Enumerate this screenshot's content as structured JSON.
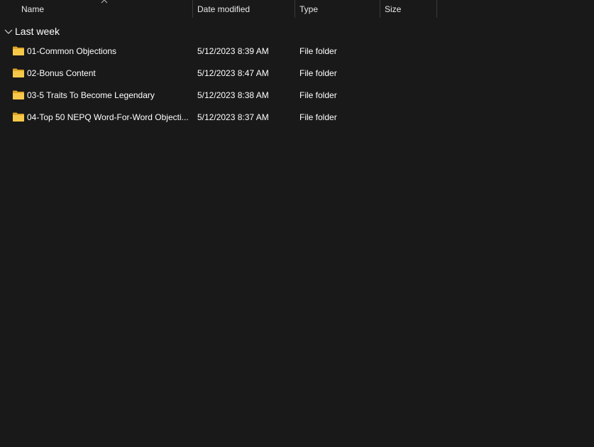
{
  "columns": {
    "name": "Name",
    "date_modified": "Date modified",
    "type": "Type",
    "size": "Size"
  },
  "group": {
    "label": "Last week"
  },
  "rows": [
    {
      "name": "01-Common Objections",
      "date": "5/12/2023 8:39 AM",
      "type": "File folder",
      "size": ""
    },
    {
      "name": "02-Bonus Content",
      "date": "5/12/2023 8:47 AM",
      "type": "File folder",
      "size": ""
    },
    {
      "name": "03-5 Traits To Become Legendary",
      "date": "5/12/2023 8:38 AM",
      "type": "File folder",
      "size": ""
    },
    {
      "name": "04-Top 50 NEPQ Word-For-Word Objecti...",
      "date": "5/12/2023 8:37 AM",
      "type": "File folder",
      "size": ""
    }
  ],
  "colors": {
    "background": "#191919",
    "folder": "#f3c13a",
    "separator": "#3a3a3a"
  },
  "icons": {
    "folder": "folder-icon",
    "sort": "sort-up-icon",
    "group": "chevron-down-icon"
  }
}
